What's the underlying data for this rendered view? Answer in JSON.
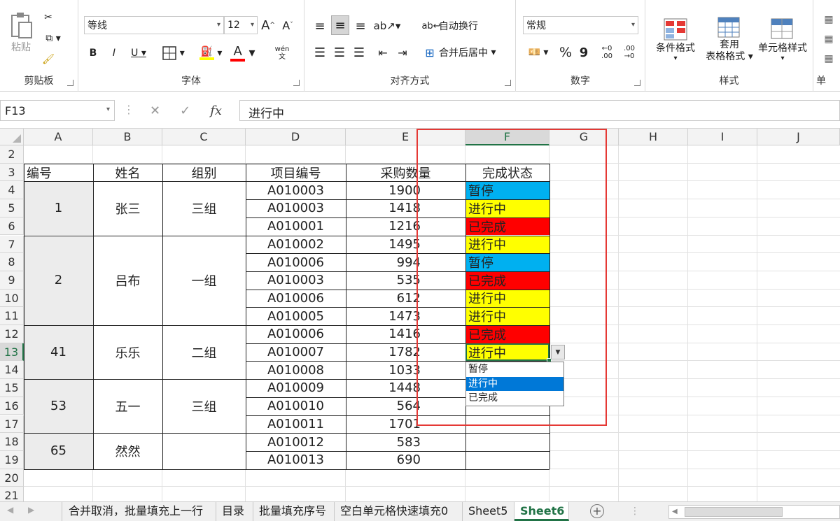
{
  "ribbon": {
    "clipboard": {
      "paste": "粘贴",
      "label": "剪贴板"
    },
    "font": {
      "name": "等线",
      "size": "12",
      "grow": "A",
      "shrink": "A",
      "bold": "B",
      "italic": "I",
      "underline": "U",
      "font_color": "A",
      "phonetic_top": "wén",
      "phonetic_bottom": "文",
      "label": "字体"
    },
    "alignment": {
      "wrap": "自动换行",
      "merge": "合并后居中",
      "label": "对齐方式"
    },
    "number": {
      "format": "常规",
      "percent": "%",
      "comma": "9",
      "inc": "←0 .00",
      "dec": ".00 →0",
      "label": "数字"
    },
    "styles": {
      "conditional": "条件格式",
      "table_line1": "套用",
      "table_line2": "表格格式",
      "cell_styles": "单元格样式",
      "label": "样式"
    },
    "cells": {
      "label": "单"
    }
  },
  "formula_bar": {
    "name_box": "F13",
    "cancel": "✕",
    "enter": "✓",
    "fx": "fx",
    "content": "进行中"
  },
  "columns": [
    "A",
    "B",
    "C",
    "D",
    "E",
    "F",
    "G",
    "H",
    "I",
    "J"
  ],
  "rows": [
    "2",
    "3",
    "4",
    "5",
    "6",
    "7",
    "8",
    "9",
    "10",
    "11",
    "12",
    "13",
    "14",
    "15",
    "16",
    "17",
    "18",
    "19",
    "20",
    "21"
  ],
  "headers": {
    "a": "编号",
    "b": "姓名",
    "c": "组别",
    "d": "项目编号",
    "e": "采购数量",
    "f": "完成状态"
  },
  "groups": [
    {
      "id": "1",
      "name": "张三",
      "group": "三组"
    },
    {
      "id": "2",
      "name": "吕布",
      "group": "一组"
    },
    {
      "id": "41",
      "name": "乐乐",
      "group": "二组"
    },
    {
      "id": "53",
      "name": "五一",
      "group": "三组"
    },
    {
      "id": "65",
      "name": "然然",
      "group": ""
    }
  ],
  "records": [
    {
      "code": "A010003",
      "qty": "1900",
      "status": "暂停"
    },
    {
      "code": "A010003",
      "qty": "1418",
      "status": "进行中"
    },
    {
      "code": "A010001",
      "qty": "1216",
      "status": "已完成"
    },
    {
      "code": "A010002",
      "qty": "1495",
      "status": "进行中"
    },
    {
      "code": "A010006",
      "qty": "994",
      "status": "暂停"
    },
    {
      "code": "A010003",
      "qty": "535",
      "status": "已完成"
    },
    {
      "code": "A010006",
      "qty": "612",
      "status": "进行中"
    },
    {
      "code": "A010005",
      "qty": "1473",
      "status": "进行中"
    },
    {
      "code": "A010006",
      "qty": "1416",
      "status": "已完成"
    },
    {
      "code": "A010007",
      "qty": "1782",
      "status": "进行中"
    },
    {
      "code": "A010008",
      "qty": "1033",
      "status": ""
    },
    {
      "code": "A010009",
      "qty": "1448",
      "status": ""
    },
    {
      "code": "A010010",
      "qty": "564",
      "status": ""
    },
    {
      "code": "A010011",
      "qty": "1701",
      "status": ""
    },
    {
      "code": "A010012",
      "qty": "583",
      "status": ""
    },
    {
      "code": "A010013",
      "qty": "690",
      "status": ""
    }
  ],
  "status_colors": {
    "暂停": "#00b0f0",
    "进行中": "#ffff00",
    "已完成": "#ff0000"
  },
  "dropdown": {
    "options": [
      "暂停",
      "进行中",
      "已完成"
    ],
    "selected": "进行中"
  },
  "highlight_color": "#e53935",
  "sheet_tabs": [
    "合并取消，批量填充上一行",
    "目录",
    "批量填充序号",
    "空白单元格快速填充0",
    "Sheet5",
    "Sheet6"
  ],
  "active_sheet": "Sheet6",
  "add_sheet": "+"
}
